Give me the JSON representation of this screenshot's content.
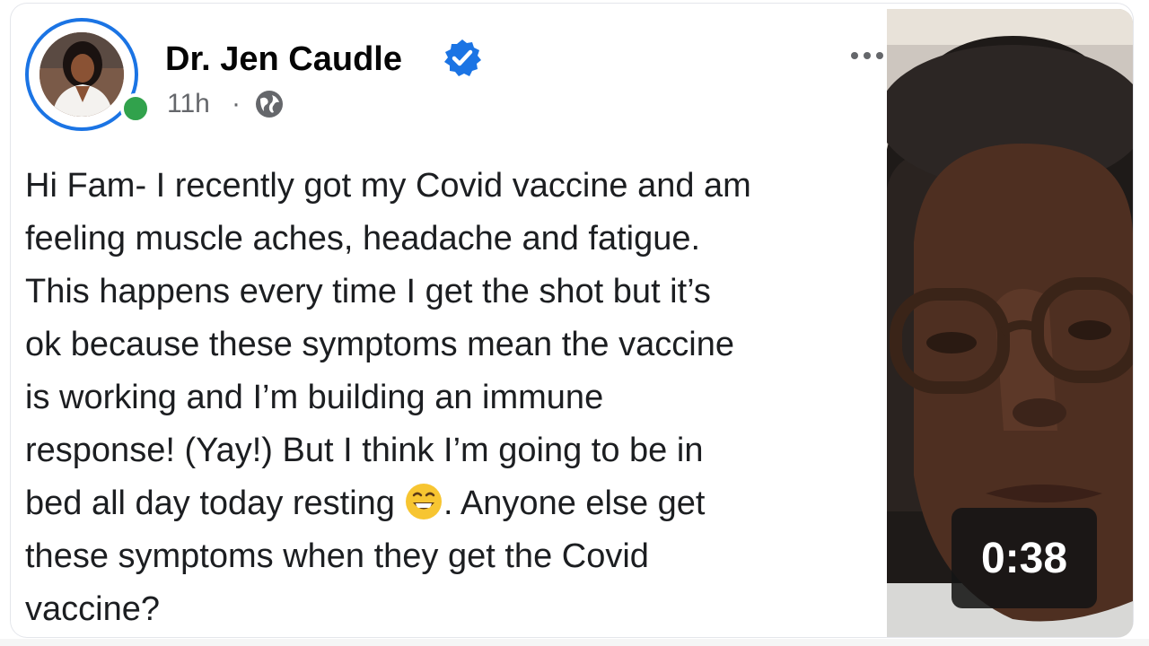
{
  "post": {
    "author": "Dr. Jen Caudle",
    "timestamp": "11h",
    "separator": "·",
    "privacy_icon": "globe-icon",
    "verified_icon": "verified-badge-icon",
    "menu_icon": "more-options-icon",
    "text_lines": [
      "Hi Fam- I recently got my Covid vaccine and am",
      "feeling muscle aches, headache and fatigue.",
      "This happens every time I get the shot but it’s",
      "ok because these symptoms mean the vaccine",
      "is working and I’m building an immune",
      "response! (Yay!) But I think I’m going to be in",
      "bed all day today resting",
      ". Anyone else get",
      "these symptoms when they get the Covid",
      "vaccine?"
    ],
    "emoji": "grinning-face-emoji-icon"
  },
  "video": {
    "duration": "0:38"
  },
  "colors": {
    "accent_blue": "#1b74e4",
    "online_green": "#31a24c",
    "text_primary": "#1c1e21",
    "text_secondary": "#65676b",
    "badge_bg": "#141414"
  }
}
